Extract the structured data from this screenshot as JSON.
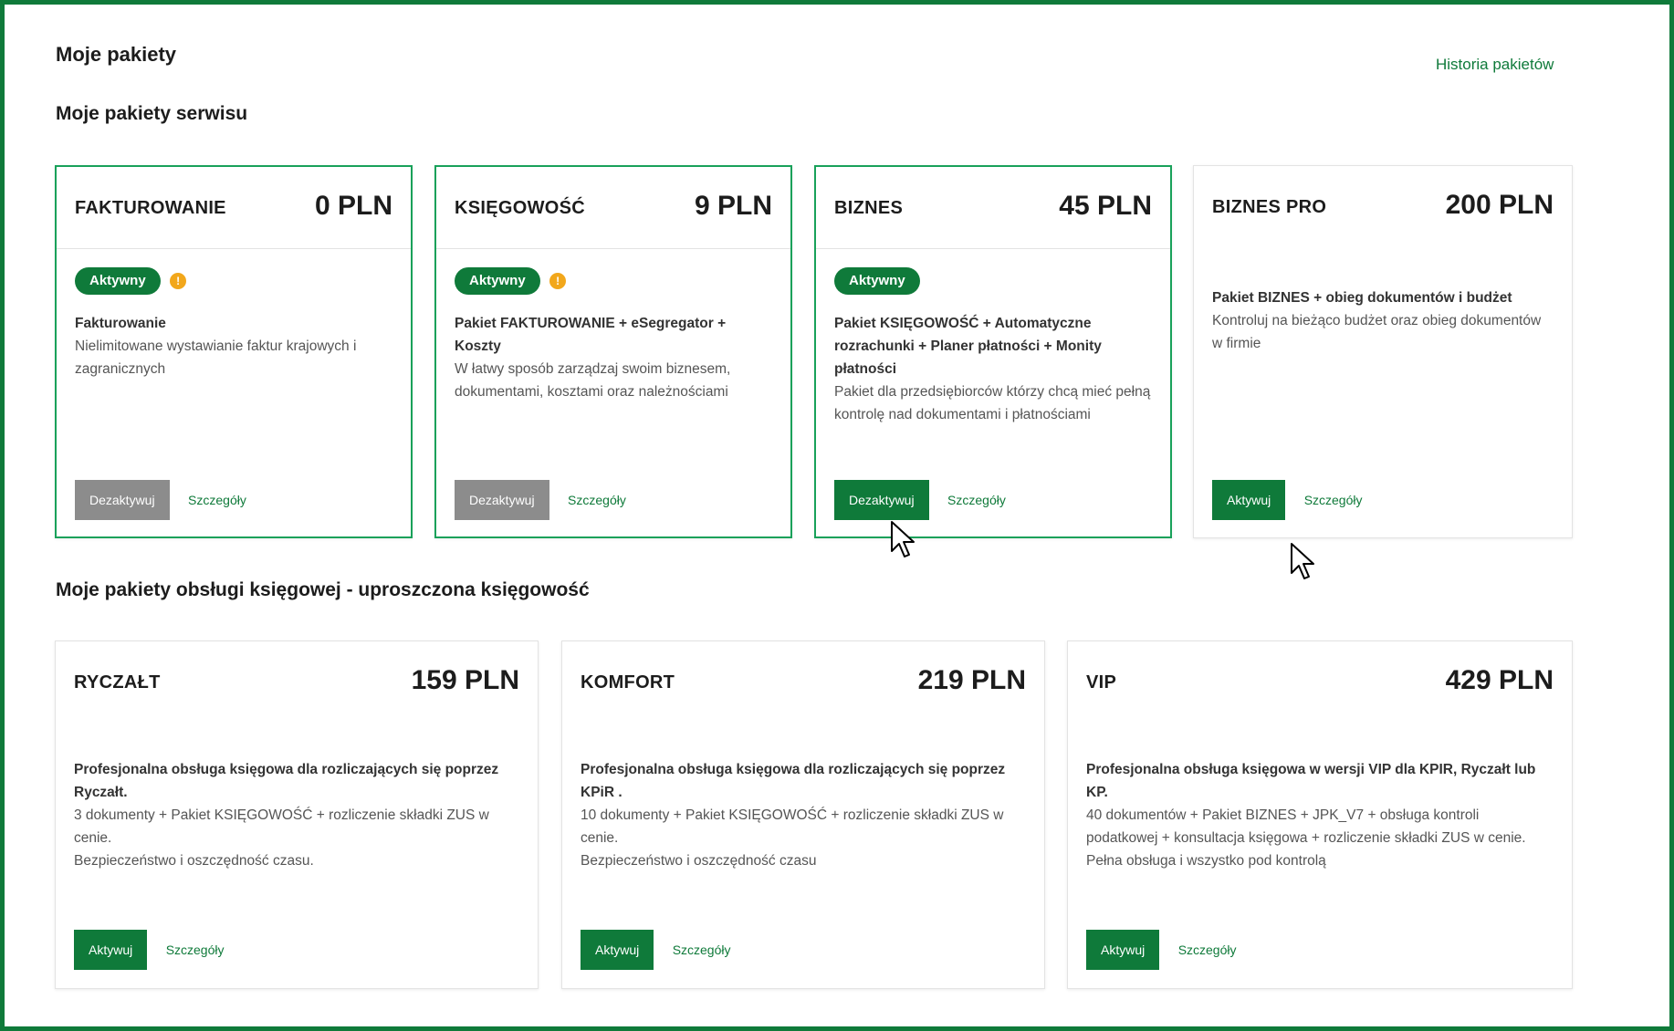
{
  "header": {
    "title": "Moje pakiety",
    "history_link": "Historia pakietów"
  },
  "sections": {
    "service": "Moje pakiety serwisu",
    "accounting": "Moje pakiety obsługi księgowej - uproszczona księgowość"
  },
  "service_packages": [
    {
      "name": "FAKTUROWANIE",
      "price": "0 PLN",
      "badge": "Aktywny",
      "lead": "Fakturowanie",
      "desc": "Nielimitowane wystawianie faktur krajowych i zagranicznych",
      "button": "Dezaktywuj",
      "details": "Szczegóły"
    },
    {
      "name": "KSIĘGOWOŚĆ",
      "price": "9 PLN",
      "badge": "Aktywny",
      "lead": "Pakiet FAKTUROWANIE + eSegregator + Koszty",
      "desc": "W łatwy sposób zarządzaj swoim biznesem, dokumentami, kosztami oraz należnościami",
      "button": "Dezaktywuj",
      "details": "Szczegóły"
    },
    {
      "name": "BIZNES",
      "price": "45 PLN",
      "badge": "Aktywny",
      "lead": "Pakiet KSIĘGOWOŚĆ + Automatyczne rozrachunki + Planer płatności + Monity płatności",
      "desc": "Pakiet dla przedsiębiorców którzy chcą mieć pełną kontrolę nad dokumentami i płatnościami",
      "button": "Dezaktywuj",
      "details": "Szczegóły"
    },
    {
      "name": "BIZNES PRO",
      "price": "200 PLN",
      "lead": "Pakiet BIZNES + obieg dokumentów i budżet",
      "desc": "Kontroluj na bieżąco budżet oraz obieg dokumentów w firmie",
      "button": "Aktywuj",
      "details": "Szczegóły"
    }
  ],
  "accounting_packages": [
    {
      "name": "RYCZAŁT",
      "price": "159 PLN",
      "lead": "Profesjonalna obsługa księgowa dla rozliczających się poprzez Ryczałt.",
      "desc": "3 dokumenty + Pakiet KSIĘGOWOŚĆ + rozliczenie składki ZUS w cenie.",
      "desc2": "Bezpieczeństwo i oszczędność czasu.",
      "button": "Aktywuj",
      "details": "Szczegóły"
    },
    {
      "name": "KOMFORT",
      "price": "219 PLN",
      "lead": "Profesjonalna obsługa księgowa dla rozliczających się poprzez KPiR .",
      "desc": "10 dokumenty + Pakiet KSIĘGOWOŚĆ + rozliczenie składki ZUS w cenie.",
      "desc2": "Bezpieczeństwo i oszczędność czasu",
      "button": "Aktywuj",
      "details": "Szczegóły"
    },
    {
      "name": "VIP",
      "price": "429 PLN",
      "lead": "Profesjonalna obsługa księgowa w wersji VIP dla KPIR, Ryczałt lub KP.",
      "desc": "40 dokumentów + Pakiet BIZNES + JPK_V7 + obsługa kontroli podatkowej + konsultacja księgowa + rozliczenie składki ZUS w cenie.",
      "desc2": "Pełna obsługa i wszystko pod kontrolą",
      "button": "Aktywuj",
      "details": "Szczegóły"
    }
  ],
  "colors": {
    "brand_green": "#0f7a3a",
    "active_border": "#19a15a",
    "disabled_gray": "#8c8c8c",
    "warning_orange": "#f2a71b"
  },
  "icons": {
    "info": "info-icon",
    "cursor": "mouse-pointer-icon"
  }
}
